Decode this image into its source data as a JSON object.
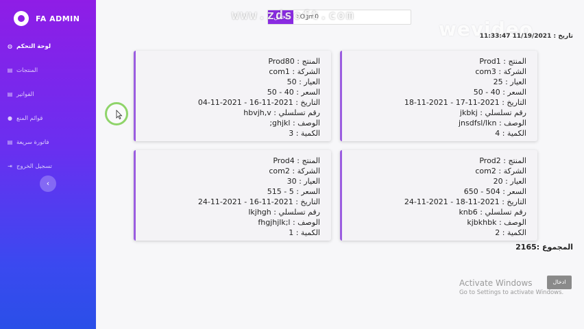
{
  "brand": {
    "name": "FA ADMIN"
  },
  "sidebar": {
    "items": [
      {
        "label": "لوحة التحكم",
        "icon": "dashboard-icon",
        "active": true
      },
      {
        "label": "المنتجات",
        "icon": "products-icon",
        "active": false
      },
      {
        "label": "الفواتير",
        "icon": "invoices-icon",
        "active": false
      },
      {
        "label": "قوائم المنع",
        "icon": "users-icon",
        "active": false
      },
      {
        "label": "فاتورة سريعة",
        "icon": "quick-invoice-icon",
        "active": false
      },
      {
        "label": "تسجيل الخروج",
        "icon": "logout-icon",
        "active": false
      }
    ],
    "collapse_icon": "chevron-left-icon"
  },
  "search": {
    "button_label": "تحقق",
    "value": "zOgm0"
  },
  "watermarks": {
    "top": "www.zdsoft.com",
    "right": "wevideo"
  },
  "datetime": "تاريخ : 11/19/2021 11:33:47",
  "cards": [
    {
      "product": "المنتج : Prod1",
      "company": "الشركة : com3",
      "caliber": "العيار : 25",
      "price": "السعر : 40 - 50",
      "date": "التاريخ : 2021-11-17 - 2021-11-18",
      "serial": "رقم تسلسلي : jkbkj",
      "description": "الوصف : jnsdfsl/lkn",
      "quantity": "الكمية : 4"
    },
    {
      "product": "المنتج : Prod80",
      "company": "الشركة : com1",
      "caliber": "العيار : 50",
      "price": "السعر : 40 - 50",
      "date": "التاريخ : 2021-11-16 - 2021-11-04",
      "serial": "رقم تسلسلي : hbvjh,v",
      "description": "الوصف : ghjkl;",
      "quantity": "الكمية : 3"
    },
    {
      "product": "المنتج : Prod2",
      "company": "الشركة : com2",
      "caliber": "العيار : 20",
      "price": "السعر : 504 - 650",
      "date": "التاريخ : 2021-11-18 - 2021-11-24",
      "serial": "رقم تسلسلي : knb6",
      "description": "الوصف : kjbkhbk",
      "quantity": "الكمية : 2"
    },
    {
      "product": "المنتج : Prod4",
      "company": "الشركة : com2",
      "caliber": "العيار : 30",
      "price": "السعر : 5 - 515",
      "date": "التاريخ : 2021-11-16 - 2021-11-24",
      "serial": "رقم تسلسلي : lkjhgh",
      "description": "الوصف : fhgjhjlk;l",
      "quantity": "الكمية : 1"
    }
  ],
  "total": "المجموع :2165",
  "enter_button": "ادخال",
  "activate_windows": {
    "title": "Activate Windows",
    "subtitle": "Go to Settings to activate Windows."
  },
  "colors": {
    "accent": "#8a2be2",
    "sidebar_top": "#8f1de6",
    "sidebar_bottom": "#2a4fe8",
    "card_border": "#9a5ce0"
  }
}
